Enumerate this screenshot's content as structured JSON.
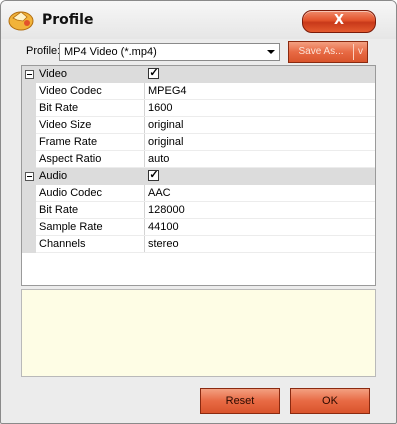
{
  "window": {
    "title": "Profile",
    "close_label": "X"
  },
  "toolbar": {
    "profile_label": "Profile:",
    "profile_value": "MP4 Video (*.mp4)",
    "save_as_label": "Save As...",
    "save_as_caret": "v"
  },
  "video": {
    "category": "Video",
    "enabled": "✓",
    "rows": [
      {
        "name": "Video Codec",
        "value": "MPEG4"
      },
      {
        "name": "Bit Rate",
        "value": "1600"
      },
      {
        "name": "Video Size",
        "value": "original"
      },
      {
        "name": "Frame Rate",
        "value": "original"
      },
      {
        "name": "Aspect Ratio",
        "value": "auto"
      }
    ]
  },
  "audio": {
    "category": "Audio",
    "enabled": "✓",
    "rows": [
      {
        "name": "Audio Codec",
        "value": "AAC"
      },
      {
        "name": "Bit Rate",
        "value": "128000"
      },
      {
        "name": "Sample Rate",
        "value": "44100"
      },
      {
        "name": "Channels",
        "value": "stereo"
      }
    ]
  },
  "buttons": {
    "reset_label": "Reset",
    "ok_label": "OK"
  }
}
